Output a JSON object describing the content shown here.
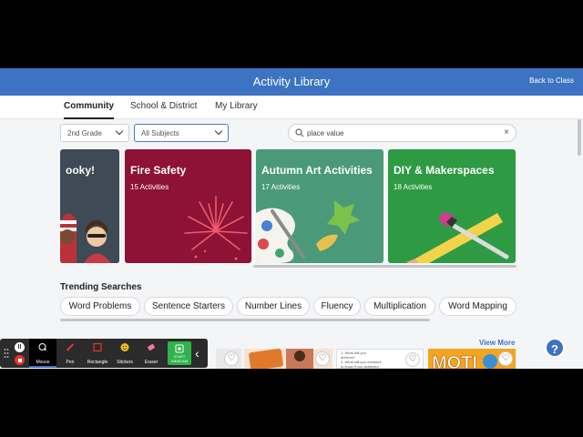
{
  "header": {
    "title": "Activity Library",
    "back_label": "Back to Class"
  },
  "tabs": [
    {
      "label": "Community",
      "active": true
    },
    {
      "label": "School & District"
    },
    {
      "label": "My Library"
    }
  ],
  "filters": {
    "grade": "2nd Grade",
    "subject": "All Subjects"
  },
  "search": {
    "value": "place value",
    "clear_label": "×"
  },
  "cards": [
    {
      "title": "ooky!",
      "count": "",
      "color": "#3e4a55"
    },
    {
      "title": "Fire Safety",
      "count": "15 Activities",
      "color": "#8d1235"
    },
    {
      "title": "Autumn Art Activities",
      "count": "17 Activities",
      "color": "#4a9a7a"
    },
    {
      "title": "DIY & Makerspaces",
      "count": "18 Activities",
      "color": "#2f9a44"
    }
  ],
  "trending": {
    "heading": "Trending Searches",
    "items": [
      "Word Problems",
      "Sentence Starters",
      "Number Lines",
      "Fluency",
      "Multiplication",
      "Word Mapping"
    ]
  },
  "view_more": "View More",
  "help_label": "?",
  "heart": "♡",
  "thumb_texts": {
    "doc_line1": "1. What will you",
    "doc_line2": "achieve?",
    "doc_line3": "2. What will you measure",
    "doc_line4": "to know if you achieved"
  },
  "toolbar": {
    "tools": [
      {
        "label": "Mouse",
        "active": true
      },
      {
        "label": "Pen"
      },
      {
        "label": "Rectangle"
      },
      {
        "label": "Stickers"
      },
      {
        "label": "Eraser"
      },
      {
        "label": "START WEBCAM"
      }
    ],
    "collapse": "‹"
  },
  "colors": {
    "header": "#3d73c3",
    "accent": "#3d73c3",
    "webcam": "#2fb34a"
  }
}
